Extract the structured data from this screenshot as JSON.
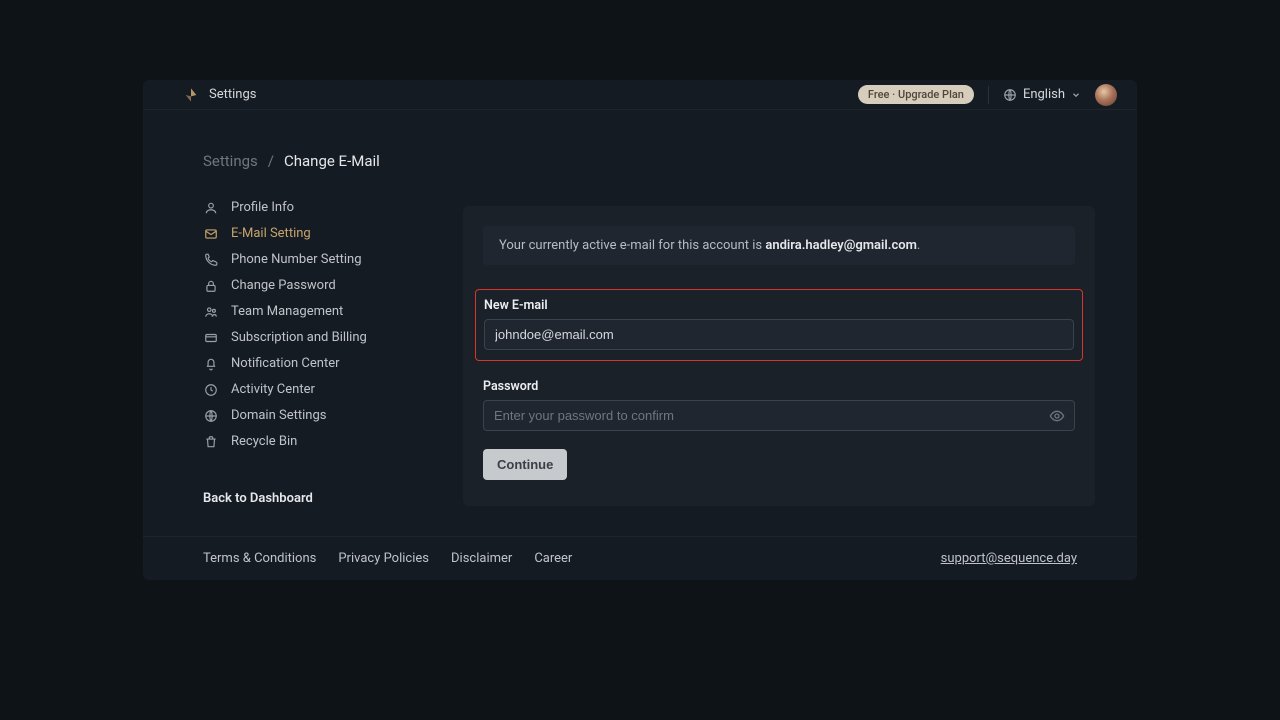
{
  "header": {
    "title": "Settings",
    "upgrade_label": "Free · Upgrade Plan",
    "language_label": "English"
  },
  "breadcrumb": {
    "root": "Settings",
    "sep": "/",
    "leaf": "Change E-Mail"
  },
  "sidebar": {
    "items": [
      {
        "icon": "user-icon",
        "label": "Profile Info"
      },
      {
        "icon": "mail-icon",
        "label": "E-Mail Setting"
      },
      {
        "icon": "phone-icon",
        "label": "Phone Number Setting"
      },
      {
        "icon": "lock-icon",
        "label": "Change Password"
      },
      {
        "icon": "team-icon",
        "label": "Team Management"
      },
      {
        "icon": "card-icon",
        "label": "Subscription and Billing"
      },
      {
        "icon": "bell-icon",
        "label": "Notification Center"
      },
      {
        "icon": "activity-icon",
        "label": "Activity Center"
      },
      {
        "icon": "globe-icon",
        "label": "Domain Settings"
      },
      {
        "icon": "trash-icon",
        "label": "Recycle Bin"
      }
    ],
    "active_index": 1,
    "back_label": "Back to Dashboard"
  },
  "main": {
    "current_email_prefix": "Your currently active e-mail for this account is ",
    "current_email": "andira.hadley@gmail.com",
    "current_email_suffix": ".",
    "new_email_label": "New E-mail",
    "new_email_value": "johndoe@email.com",
    "password_label": "Password",
    "password_placeholder": "Enter your password to confirm",
    "continue_label": "Continue"
  },
  "footer": {
    "links": [
      "Terms & Conditions",
      "Privacy Policies",
      "Disclaimer",
      "Career"
    ],
    "support_email": "support@sequence.day"
  }
}
